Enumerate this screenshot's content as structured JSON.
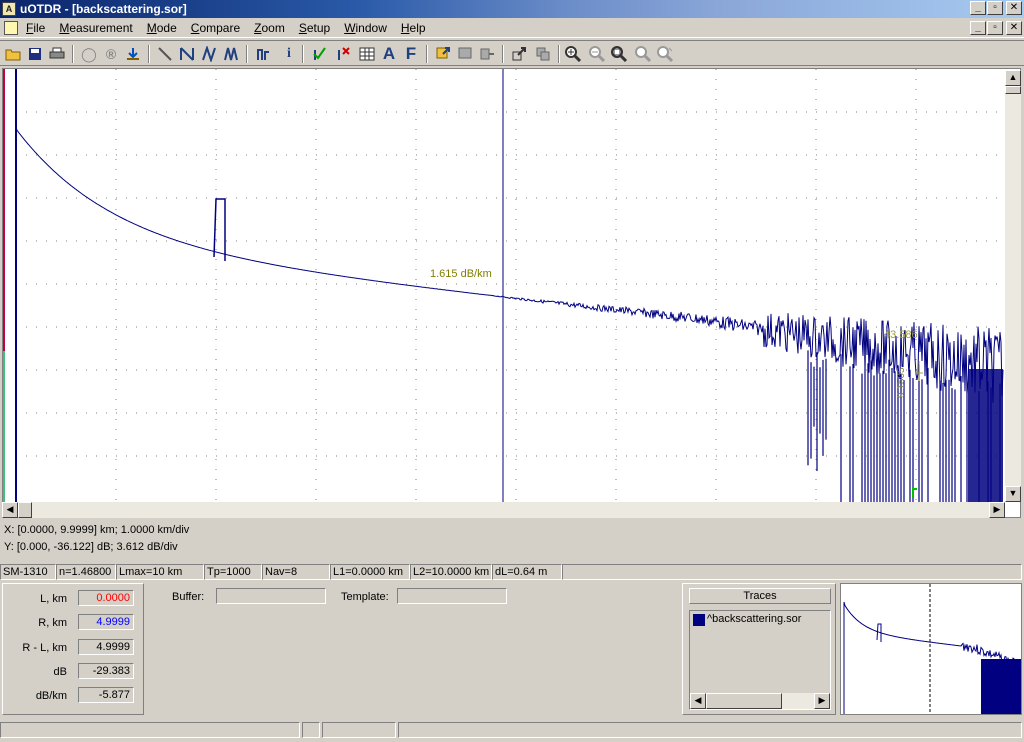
{
  "window": {
    "title": "uOTDR - [backscattering.sor]"
  },
  "menu": [
    "File",
    "Measurement",
    "Mode",
    "Compare",
    "Zoom",
    "Setup",
    "Window",
    "Help"
  ],
  "plot": {
    "annotation_slope": "1.615 dB/km",
    "annotation_level": "43.586",
    "annotation_db": "9.1505",
    "trace_color": "#000080",
    "cursor_color": "#000080"
  },
  "axis_info": {
    "x": "X: [0.0000, 9.9999] km; 1.0000 km/div",
    "y": "Y: [0.000, -36.122] dB; 3.612 dB/div"
  },
  "status": {
    "fiber": "SM-1310",
    "n": "n=1.46800",
    "lmax": "Lmax=10 km",
    "tp": "Tp=1000",
    "nav": "Nav=8",
    "l1": "L1=0.0000 km",
    "l2": "L2=10.0000 km",
    "dl": "dL=0.64 m"
  },
  "measure": {
    "l_label": "L, km",
    "l_value": "0.0000",
    "r_label": "R, km",
    "r_value": "4.9999",
    "rl_label": "R - L, km",
    "rl_value": "4.9999",
    "db_label": "dB",
    "db_value": "-29.383",
    "dbkm_label": "dB/km",
    "dbkm_value": "-5.877"
  },
  "buffer": {
    "label": "Buffer:"
  },
  "template": {
    "label": "Template:"
  },
  "traces": {
    "title": "Traces",
    "items": [
      "^backscattering.sor"
    ]
  },
  "colors": {
    "l_value": "#ff0000",
    "r_value": "#0000ff"
  }
}
